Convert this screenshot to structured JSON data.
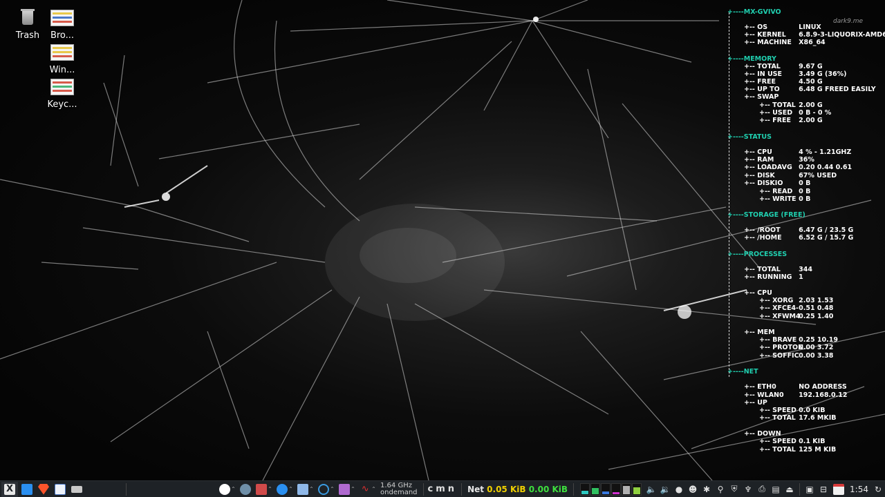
{
  "desktop": {
    "icons": [
      {
        "label": "Trash",
        "icon": "trash-icon"
      },
      {
        "label": "Bro...",
        "icon": "spreadsheet-icon"
      },
      {
        "label": "Win...",
        "icon": "spreadsheet-icon"
      },
      {
        "label": "Keyc...",
        "icon": "spreadsheet-icon"
      }
    ],
    "watermark": "dark9.me"
  },
  "conky": {
    "host": "MX-GVIVO",
    "system": [
      {
        "k": "OS",
        "v": "LINUX"
      },
      {
        "k": "KERNEL",
        "v": "6.8.9-3-LIQUORIX-AMD6"
      },
      {
        "k": "MACHINE",
        "v": "X86_64"
      }
    ],
    "memory_title": "MEMORY",
    "memory": [
      {
        "k": "TOTAL",
        "v": "9.67 G"
      },
      {
        "k": "IN USE",
        "v": "3.49 G (36%)"
      },
      {
        "k": "FREE",
        "v": "4.50 G"
      },
      {
        "k": "UP TO",
        "v": "6.48 G FREED EASILY"
      },
      {
        "k": "SWAP",
        "v": ""
      }
    ],
    "swap": [
      {
        "k": "TOTAL",
        "v": "2.00 G"
      },
      {
        "k": "USED",
        "v": "0 B   - 0 %"
      },
      {
        "k": "FREE",
        "v": "2.00 G"
      }
    ],
    "status_title": "STATUS",
    "status": [
      {
        "k": "CPU",
        "v": "4 % - 1.21GHZ"
      },
      {
        "k": "RAM",
        "v": "36%"
      },
      {
        "k": "LOADAVG",
        "v": "0.20 0.44 0.61"
      },
      {
        "k": "DISK",
        "v": "67% USED"
      },
      {
        "k": "DISKIO",
        "v": "0 B"
      }
    ],
    "diskio": [
      {
        "k": "READ",
        "v": "0 B"
      },
      {
        "k": "WRITE",
        "v": "0 B"
      }
    ],
    "storage_title": "STORAGE (FREE)",
    "storage": [
      {
        "k": "/ROOT",
        "v": "6.47 G / 23.5 G"
      },
      {
        "k": "/HOME",
        "v": "6.52 G / 15.7 G"
      }
    ],
    "processes_title": "PROCESSES",
    "processes": [
      {
        "k": "TOTAL",
        "v": "344"
      },
      {
        "k": "RUNNING",
        "v": "1"
      }
    ],
    "proc_cpu_label": "CPU",
    "proc_cpu": [
      {
        "k": "XORG",
        "v": "2.03  1.53"
      },
      {
        "k": "XFCE4-",
        "v": "0.51  0.48"
      },
      {
        "k": "XFWM4",
        "v": "0.25  1.40"
      }
    ],
    "proc_mem_label": "MEM",
    "proc_mem": [
      {
        "k": "BRAVE",
        "v": "0.25 10.19"
      },
      {
        "k": "PROTON",
        "v": "0.00  3.72"
      },
      {
        "k": "SOFFIC",
        "v": "0.00  3.38"
      }
    ],
    "net_title": "NET",
    "net": [
      {
        "k": "ETH0",
        "v": "NO ADDRESS"
      },
      {
        "k": "WLAN0",
        "v": "192.168.0.12"
      },
      {
        "k": "UP",
        "v": ""
      }
    ],
    "net_up": [
      {
        "k": "SPEED",
        "v": "0.0    KIB"
      },
      {
        "k": "TOTAL",
        "v": "17.6 MKIB"
      }
    ],
    "down_label": "DOWN",
    "net_down": [
      {
        "k": "SPEED",
        "v": "0.1    KIB"
      },
      {
        "k": "TOTAL",
        "v": "125 M KIB"
      }
    ],
    "colors": {
      "section": "#20d0b0",
      "text": "#ffffff"
    }
  },
  "taskbar": {
    "cpu_freq": "1.64 GHz",
    "governor": "ondemand",
    "keys": [
      "c",
      "m",
      "n"
    ],
    "net_label": "Net",
    "net_down": "0.05 KiB",
    "net_up": "0.00 KiB",
    "net_down_color": "#f0d000",
    "net_up_color": "#3ee03e",
    "clock": "1:54"
  }
}
